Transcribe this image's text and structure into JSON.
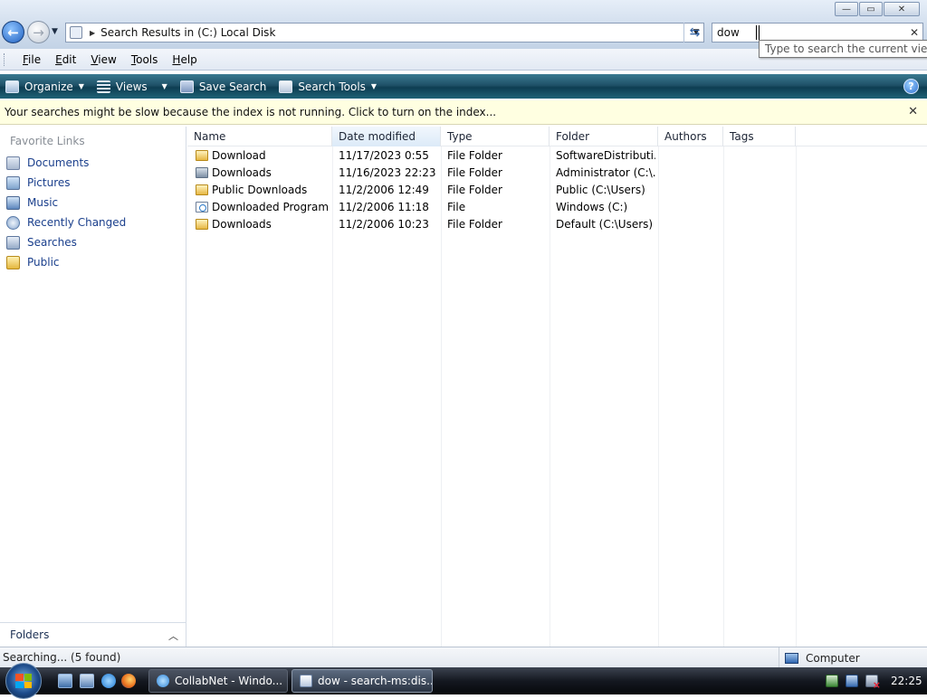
{
  "window": {
    "address": "Search Results in (C:) Local Disk",
    "search_value": "dow",
    "search_tooltip": "Type to search the current view",
    "controls": {
      "minimize": "—",
      "maximize": "▭",
      "close": "✕"
    }
  },
  "menubar": {
    "items": [
      {
        "label": "File",
        "accel": "F",
        "rest": "ile"
      },
      {
        "label": "Edit",
        "accel": "E",
        "rest": "dit"
      },
      {
        "label": "View",
        "accel": "V",
        "rest": "iew"
      },
      {
        "label": "Tools",
        "accel": "T",
        "rest": "ools"
      },
      {
        "label": "Help",
        "accel": "H",
        "rest": "elp"
      }
    ]
  },
  "commandbar": {
    "organize": "Organize",
    "views": "Views",
    "save_search": "Save Search",
    "search_tools": "Search Tools",
    "help": "?"
  },
  "infobar": {
    "message": "Your searches might be slow because the index is not running.  Click to turn on the index..."
  },
  "nav": {
    "title": "Favorite Links",
    "links": [
      {
        "label": "Documents",
        "icon": "documents-icon"
      },
      {
        "label": "Pictures",
        "icon": "pictures-icon"
      },
      {
        "label": "Music",
        "icon": "music-icon"
      },
      {
        "label": "Recently Changed",
        "icon": "recently-changed-icon"
      },
      {
        "label": "Searches",
        "icon": "searches-icon"
      },
      {
        "label": "Public",
        "icon": "public-folder-icon"
      }
    ],
    "folders_label": "Folders"
  },
  "list": {
    "columns": [
      "Name",
      "Date modified",
      "Type",
      "Folder",
      "Authors",
      "Tags"
    ],
    "rows": [
      {
        "name": "Download",
        "date": "11/17/2023 0:55",
        "type": "File Folder",
        "folder": "SoftwareDistributi...",
        "icon": "folder-icon"
      },
      {
        "name": "Downloads",
        "date": "11/16/2023 22:23",
        "type": "File Folder",
        "folder": "Administrator (C:\\...",
        "icon": "special-folder-icon"
      },
      {
        "name": "Public Downloads",
        "date": "11/2/2006 12:49",
        "type": "File Folder",
        "folder": "Public (C:\\Users)",
        "icon": "folder-icon"
      },
      {
        "name": "Downloaded Program ...",
        "date": "11/2/2006 11:18",
        "type": "File",
        "folder": "Windows (C:)",
        "icon": "file-icon"
      },
      {
        "name": "Downloads",
        "date": "11/2/2006 10:23",
        "type": "File Folder",
        "folder": "Default (C:\\Users)",
        "icon": "folder-icon"
      }
    ]
  },
  "status": {
    "left": "Searching... (5 found)",
    "right": "Computer"
  },
  "taskbar": {
    "tasks": [
      "CollabNet - Windo...",
      "dow - search-ms:dis..."
    ],
    "clock": "22:25"
  }
}
